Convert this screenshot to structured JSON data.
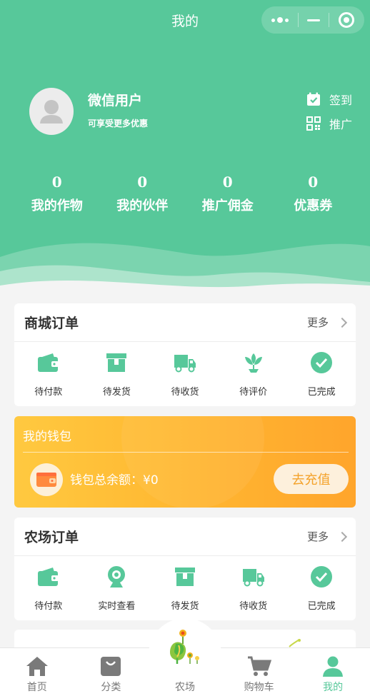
{
  "header": {
    "title": "我的",
    "bg_color": "#57c89a"
  },
  "user": {
    "name": "微信用户",
    "subtitle": "可享受更多优惠",
    "signin_label": "签到",
    "promote_label": "推广"
  },
  "stats": [
    {
      "value": "0",
      "label": "我的作物"
    },
    {
      "value": "0",
      "label": "我的伙伴"
    },
    {
      "value": "0",
      "label": "推广佣金"
    },
    {
      "value": "0",
      "label": "优惠券"
    }
  ],
  "mall_orders": {
    "title": "商城订单",
    "more": "更多",
    "items": [
      {
        "label": "待付款",
        "icon": "wallet-icon"
      },
      {
        "label": "待发货",
        "icon": "box-icon"
      },
      {
        "label": "待收货",
        "icon": "truck-icon"
      },
      {
        "label": "待评价",
        "icon": "lotus-icon"
      },
      {
        "label": "已完成",
        "icon": "check-circle-icon"
      }
    ]
  },
  "wallet": {
    "title": "我的钱包",
    "balance_label": "钱包总余额：",
    "balance": "¥0",
    "recharge": "去充值"
  },
  "farm_orders": {
    "title": "农场订单",
    "more": "更多",
    "items": [
      {
        "label": "待付款",
        "icon": "wallet-icon"
      },
      {
        "label": "实时查看",
        "icon": "webcam-icon"
      },
      {
        "label": "待发货",
        "icon": "box-icon"
      },
      {
        "label": "待收货",
        "icon": "truck-icon"
      },
      {
        "label": "已完成",
        "icon": "check-circle-icon"
      }
    ]
  },
  "tabbar": [
    {
      "label": "首页",
      "icon": "home-icon",
      "active": false
    },
    {
      "label": "分类",
      "icon": "bag-icon",
      "active": false
    },
    {
      "label": "农场",
      "icon": "farm-icon",
      "active": false
    },
    {
      "label": "购物车",
      "icon": "cart-icon",
      "active": false
    },
    {
      "label": "我的",
      "icon": "person-icon",
      "active": true
    }
  ],
  "colors": {
    "accent": "#57c89a",
    "wallet_start": "#ffc940",
    "wallet_end": "#ffa52c"
  }
}
